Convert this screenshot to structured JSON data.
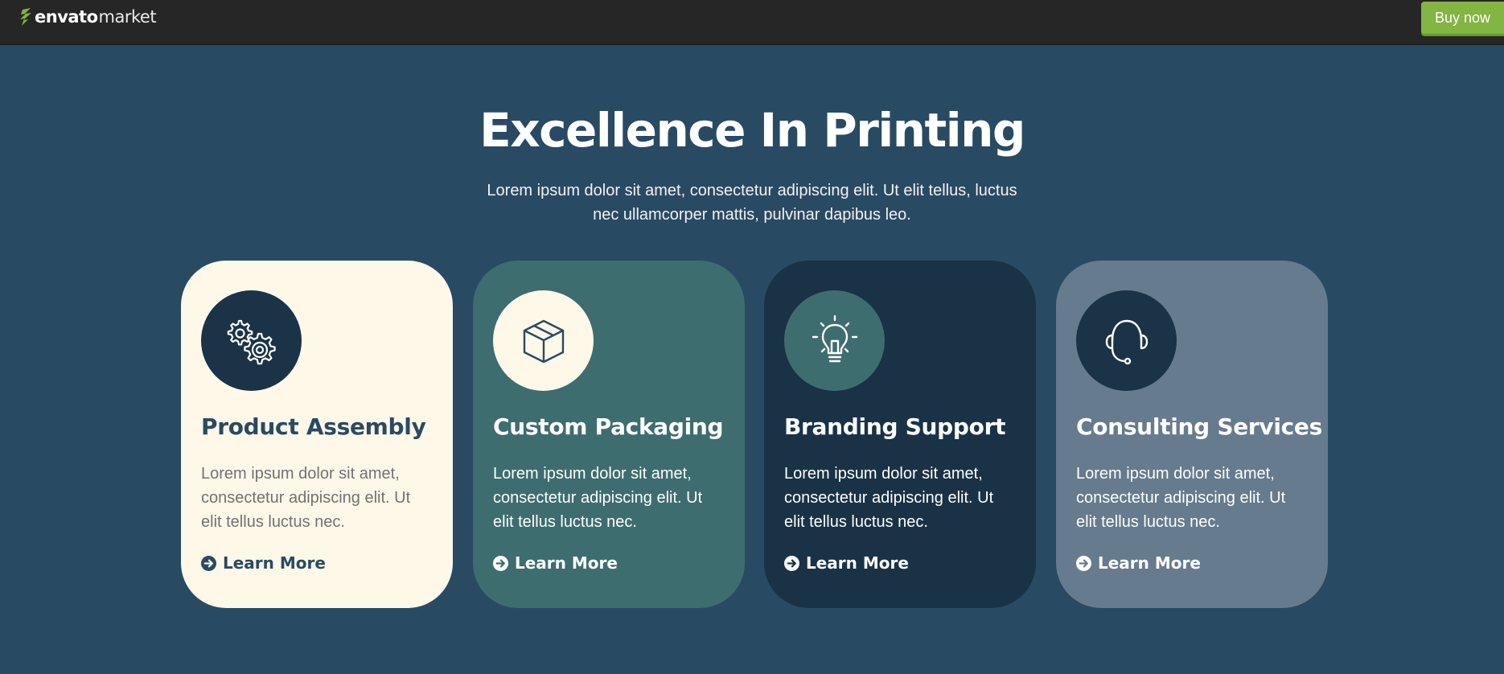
{
  "header": {
    "logo_brand": "envato",
    "logo_sub": "market",
    "buy_label": "Buy now"
  },
  "hero": {
    "title": "Excellence In Printing",
    "subtitle": "Lorem ipsum dolor sit amet, consectetur adipiscing elit. Ut elit tellus, luctus nec ullamcorper mattis, pulvinar dapibus leo."
  },
  "cards": [
    {
      "icon": "gears-icon",
      "title": "Product Assembly",
      "description": "Lorem ipsum dolor sit amet, consectetur adipiscing elit. Ut elit tellus luctus nec.",
      "link_label": "Learn More"
    },
    {
      "icon": "box-icon",
      "title": "Custom Packaging",
      "description": "Lorem ipsum dolor sit amet, consectetur adipiscing elit. Ut elit tellus luctus nec.",
      "link_label": "Learn More"
    },
    {
      "icon": "lightbulb-icon",
      "title": "Branding Support",
      "description": "Lorem ipsum dolor sit amet, consectetur adipiscing elit. Ut elit tellus luctus nec.",
      "link_label": "Learn More"
    },
    {
      "icon": "headset-icon",
      "title": "Consulting Services",
      "description": "Lorem ipsum dolor sit amet, consectetur adipiscing elit. Ut elit tellus luctus nec.",
      "link_label": "Learn More"
    }
  ],
  "colors": {
    "page_background": "#294a63",
    "topbar": "#262626",
    "buy_button": "#82b541",
    "card_cream": "#fdf8e8",
    "card_teal": "#3e6d70",
    "card_navy": "#193246",
    "card_slate": "#667b8d"
  }
}
